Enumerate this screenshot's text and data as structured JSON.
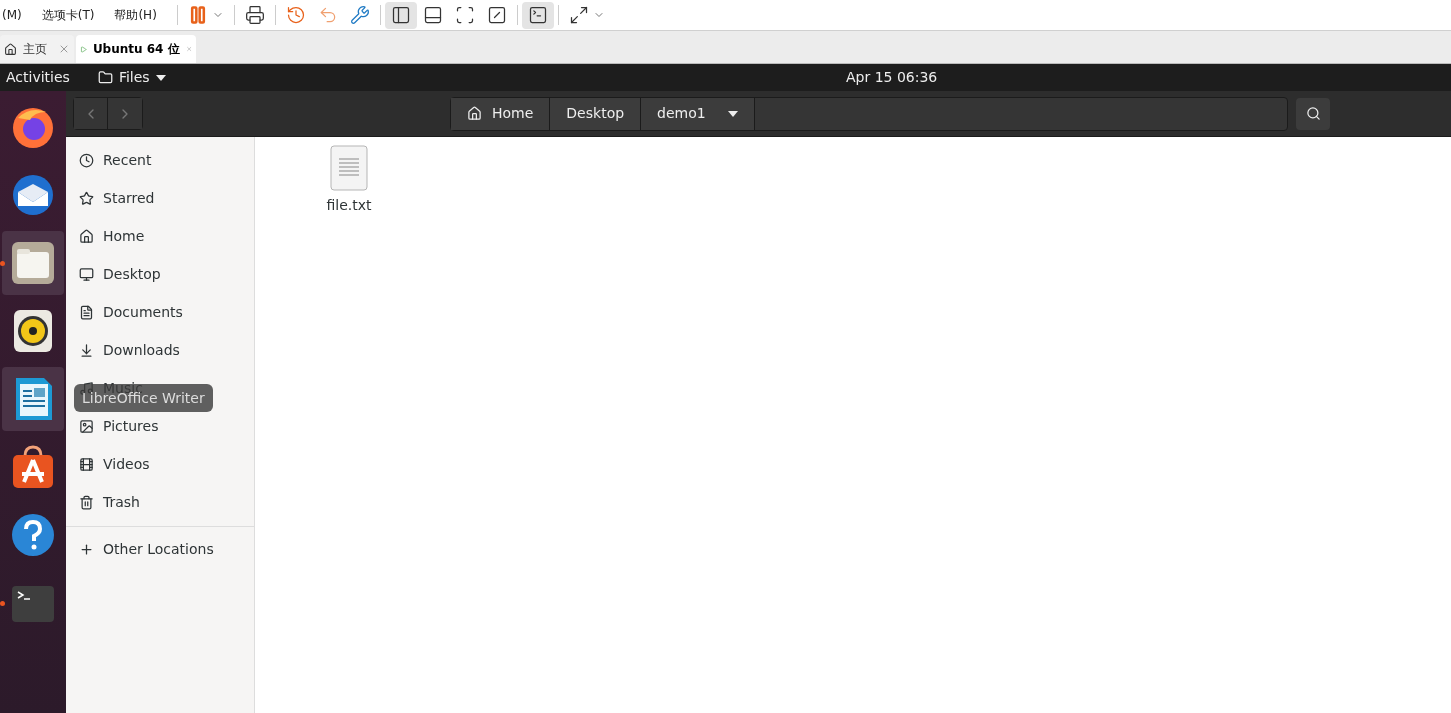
{
  "vm_menu": [
    "(M)",
    "选项卡(T)",
    "帮助(H)"
  ],
  "vm_toolbar": [
    {
      "kind": "pause",
      "selected": false
    },
    {
      "kind": "send-keys",
      "selected": false
    },
    {
      "kind": "snapshot-take",
      "selected": false
    },
    {
      "kind": "snapshot-revert",
      "selected": false
    },
    {
      "kind": "snapshot-manage",
      "selected": false
    },
    {
      "kind": "sidebar",
      "selected": true
    },
    {
      "kind": "thumbnail",
      "selected": false
    },
    {
      "kind": "fullscreen",
      "selected": false
    },
    {
      "kind": "unity",
      "selected": false
    },
    {
      "kind": "console",
      "selected": true
    },
    {
      "kind": "stretch",
      "selected": false
    }
  ],
  "vm_tabs": [
    {
      "label": "主页",
      "kind": "home",
      "selected": false
    },
    {
      "label": "Ubuntu 64 位",
      "kind": "vm",
      "selected": true
    }
  ],
  "top_bar": {
    "activities": "Activities",
    "app_menu": "Files",
    "clock": "Apr 15  06:36"
  },
  "dock": [
    {
      "kind": "firefox",
      "highlighted": false,
      "running": false
    },
    {
      "kind": "thunderbird",
      "highlighted": false,
      "running": false
    },
    {
      "kind": "files",
      "highlighted": true,
      "running": true
    },
    {
      "kind": "rhythmbox",
      "highlighted": false,
      "running": false
    },
    {
      "kind": "writer",
      "highlighted": true,
      "running": false
    },
    {
      "kind": "software",
      "highlighted": false,
      "running": false
    },
    {
      "kind": "help",
      "highlighted": false,
      "running": false
    },
    {
      "kind": "terminal",
      "highlighted": false,
      "running": true
    }
  ],
  "tooltip": "LibreOffice Writer",
  "path_bar": [
    "Home",
    "Desktop",
    "demo1"
  ],
  "sidebar": {
    "items": [
      {
        "label": "Recent",
        "kind": "recent"
      },
      {
        "label": "Starred",
        "kind": "starred"
      },
      {
        "label": "Home",
        "kind": "home"
      },
      {
        "label": "Desktop",
        "kind": "desktop"
      },
      {
        "label": "Documents",
        "kind": "documents"
      },
      {
        "label": "Downloads",
        "kind": "downloads"
      },
      {
        "label": "Music",
        "kind": "music"
      },
      {
        "label": "Pictures",
        "kind": "pictures"
      },
      {
        "label": "Videos",
        "kind": "videos"
      },
      {
        "label": "Trash",
        "kind": "trash"
      }
    ],
    "other": "Other Locations"
  },
  "files": [
    {
      "name": "file.txt"
    }
  ]
}
